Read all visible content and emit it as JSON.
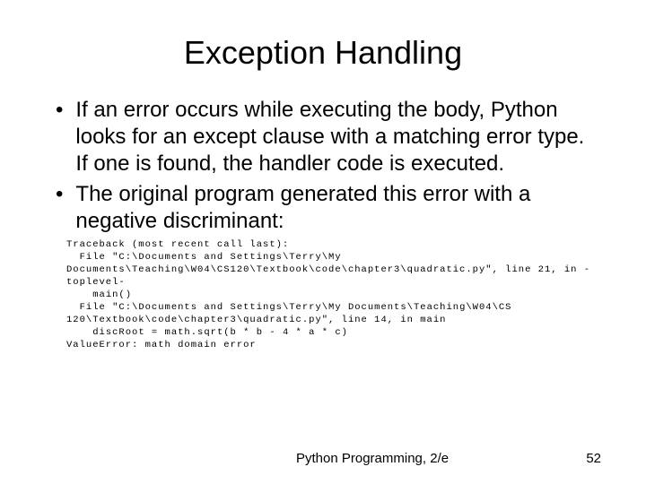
{
  "slide": {
    "title": "Exception Handling",
    "bullets": [
      "If an error occurs while executing the body, Python looks for an except clause with a matching error type. If one is found, the handler code is executed.",
      "The original program generated this error with a negative discriminant:"
    ],
    "traceback": "Traceback (most recent call last):\n  File \"C:\\Documents and Settings\\Terry\\My Documents\\Teaching\\W04\\CS120\\Textbook\\code\\chapter3\\quadratic.py\", line 21, in -toplevel-\n    main()\n  File \"C:\\Documents and Settings\\Terry\\My Documents\\Teaching\\W04\\CS 120\\Textbook\\code\\chapter3\\quadratic.py\", line 14, in main\n    discRoot = math.sqrt(b * b - 4 * a * c)\nValueError: math domain error"
  },
  "footer": {
    "text": "Python Programming, 2/e",
    "page": "52"
  }
}
